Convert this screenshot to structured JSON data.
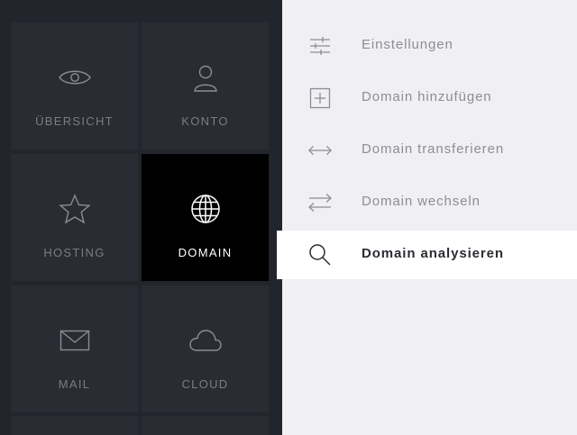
{
  "tiles": [
    {
      "label": "ÜBERSICHT",
      "icon": "eye-icon"
    },
    {
      "label": "KONTO",
      "icon": "user-icon"
    },
    {
      "label": "HOSTING",
      "icon": "star-icon"
    },
    {
      "label": "DOMAIN",
      "icon": "globe-icon",
      "active": true
    },
    {
      "label": "MAIL",
      "icon": "envelope-icon"
    },
    {
      "label": "CLOUD",
      "icon": "cloud-icon"
    }
  ],
  "menu": {
    "items": [
      {
        "label": "Einstellungen",
        "icon": "sliders-icon"
      },
      {
        "label": "Domain hinzufügen",
        "icon": "plus-box-icon"
      },
      {
        "label": "Domain transferieren",
        "icon": "double-arrow-icon"
      },
      {
        "label": "Domain wechseln",
        "icon": "swap-arrows-icon"
      },
      {
        "label": "Domain analysieren",
        "icon": "search-icon",
        "active": true
      }
    ]
  },
  "colors": {
    "panel_dark": "#22252b",
    "tile": "#292c33",
    "tile_active": "#000000",
    "menu_bg": "#f0f0f4",
    "menu_active_bg": "#ffffff",
    "muted_text": "#8b8e94"
  }
}
